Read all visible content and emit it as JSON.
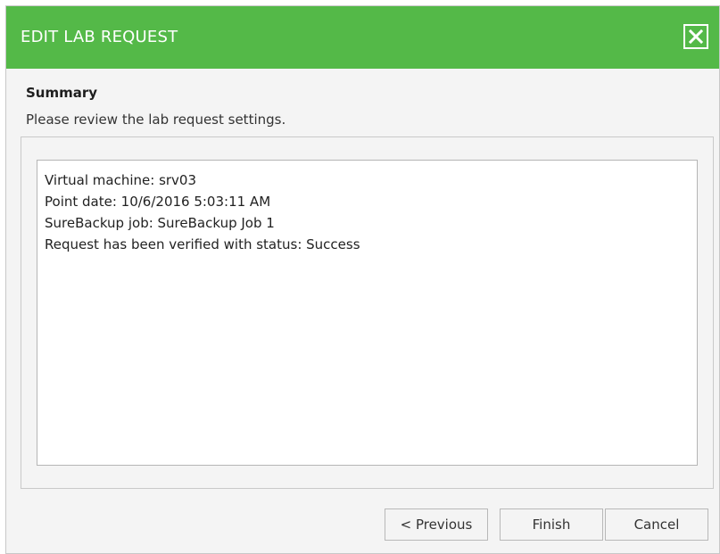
{
  "dialog": {
    "title": "EDIT LAB REQUEST",
    "close_icon": "close-icon"
  },
  "step": {
    "heading": "Summary",
    "description": "Please review the lab request settings."
  },
  "summary": {
    "lines": [
      "Virtual machine: srv03",
      "Point date: 10/6/2016 5:03:11 AM",
      "SureBackup job: SureBackup Job 1",
      "Request has been verified with status: Success"
    ]
  },
  "buttons": {
    "previous": "< Previous",
    "finish": "Finish",
    "cancel": "Cancel"
  },
  "colors": {
    "header": "#54b948",
    "header_text": "#ffffff",
    "background": "#f4f4f4"
  }
}
